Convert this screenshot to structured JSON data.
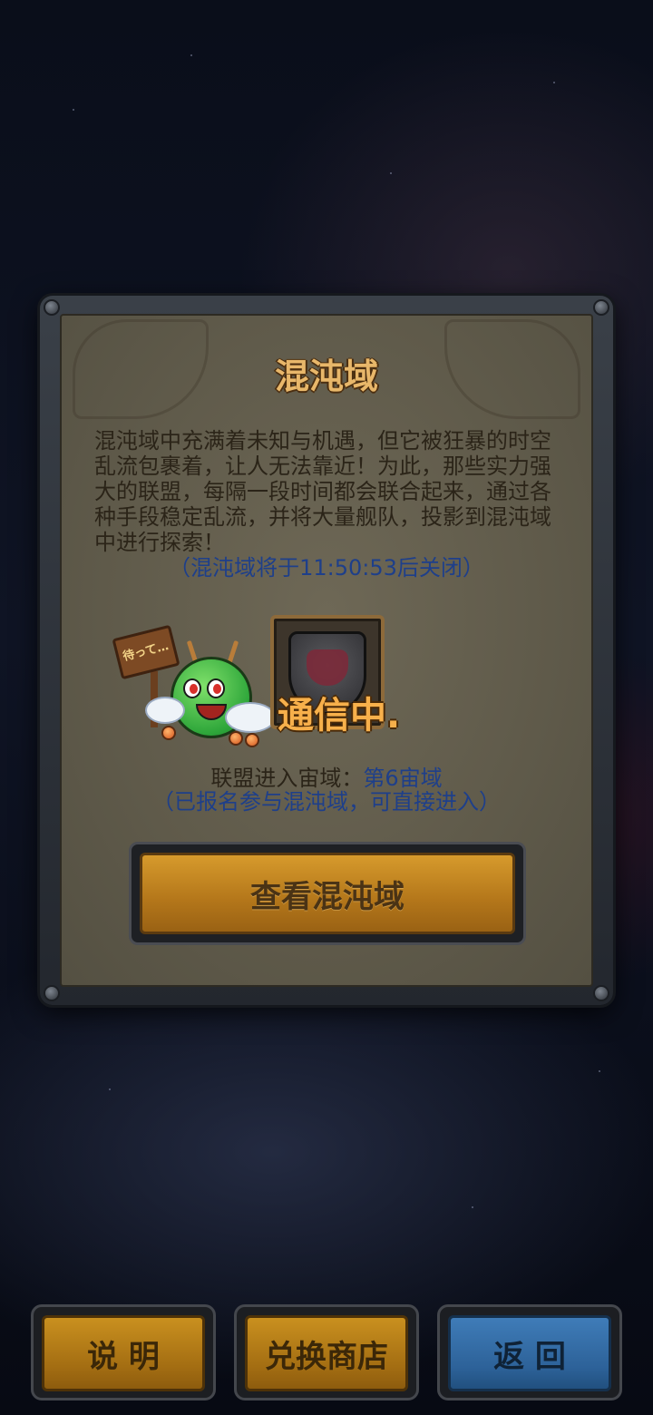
{
  "dialog": {
    "title": "混沌域",
    "description": "混沌域中充满着未知与机遇，但它被狂暴的时空乱流包裹着，让人无法靠近！为此，那些实力强大的联盟，每隔一段时间都会联合起来，通过各种手段稳定乱流，并将大量舰队，投影到混沌域中进行探索！",
    "close_notice": "（混沌域将于11:50:53后关闭）",
    "mascot_sign_text": "待って…",
    "communicating_text": "通信中.",
    "zone_label": "联盟进入宙域：",
    "zone_value": "第6宙域",
    "enter_notice": "（已报名参与混沌域，可直接进入）",
    "view_button_label": "查看混沌域"
  },
  "bottom_bar": {
    "info_label": "说 明",
    "shop_label": "兑换商店",
    "back_label": "返 回"
  },
  "colors": {
    "panel_bg": "#5f5a4a",
    "title_gold": "#e8b76a",
    "link_blue": "#1e3f8a",
    "button_gold": "#b3761a",
    "button_blue": "#2d6299"
  }
}
